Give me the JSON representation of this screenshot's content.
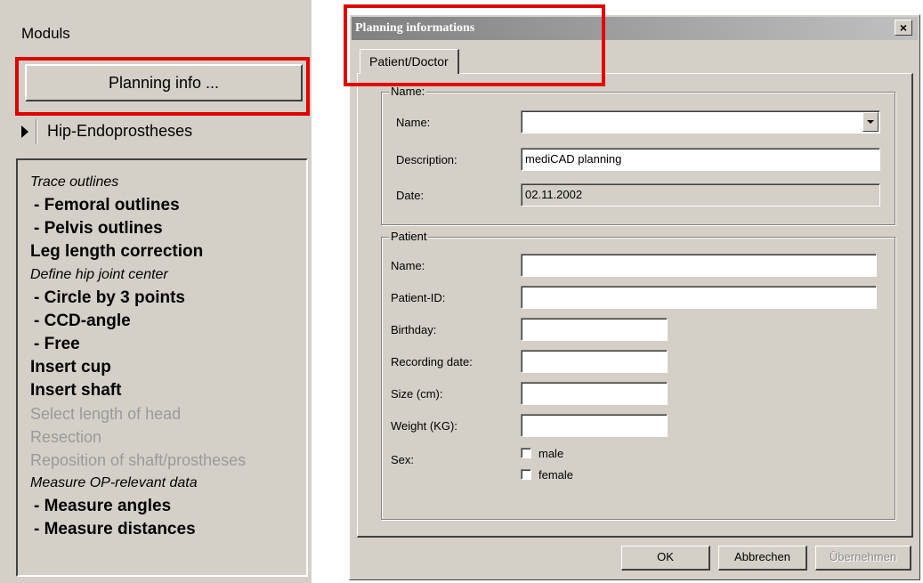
{
  "modules": {
    "title": "Moduls",
    "planning_button": "Planning info ...",
    "hip_item": "Hip-Endoprostheses",
    "steps": [
      {
        "text": "Trace outlines",
        "style": "heading"
      },
      {
        "text": "- Femoral outlines",
        "style": "bold-sub"
      },
      {
        "text": "- Pelvis outlines",
        "style": "bold-sub"
      },
      {
        "text": "Leg length correction",
        "style": "bold"
      },
      {
        "text": "Define hip joint center",
        "style": "heading"
      },
      {
        "text": "- Circle by 3 points",
        "style": "bold-sub"
      },
      {
        "text": "- CCD-angle",
        "style": "bold-sub"
      },
      {
        "text": "- Free",
        "style": "bold-sub"
      },
      {
        "text": "Insert cup",
        "style": "bold"
      },
      {
        "text": "Insert shaft",
        "style": "bold"
      },
      {
        "text": "Select length of head",
        "style": "disabled"
      },
      {
        "text": "Resection",
        "style": "disabled"
      },
      {
        "text": "Reposition of shaft/prostheses",
        "style": "disabled"
      },
      {
        "text": "Measure OP-relevant data",
        "style": "heading"
      },
      {
        "text": "- Measure angles",
        "style": "bold-sub"
      },
      {
        "text": "- Measure distances",
        "style": "bold-sub"
      }
    ]
  },
  "dialog": {
    "title": "Planning informations",
    "close_glyph": "×",
    "tab": "Patient/Doctor",
    "name_group": {
      "title": "Name:",
      "name_label": "Name:",
      "name_value": "",
      "description_label": "Description:",
      "description_value": "mediCAD planning",
      "date_label": "Date:",
      "date_value": "02.11.2002"
    },
    "patient_group": {
      "title": "Patient",
      "name_label": "Name:",
      "id_label": "Patient-ID:",
      "birthday_label": "Birthday:",
      "recording_label": "Recording date:",
      "size_label": "Size (cm):",
      "weight_label": "Weight (KG):",
      "sex_label": "Sex:",
      "male": "male",
      "female": "female"
    },
    "buttons": {
      "ok": "OK",
      "cancel": "Abbrechen",
      "apply": "Übernehmen"
    }
  },
  "colors": {
    "window_bg": "#d4d0c8",
    "highlight": "#e00000"
  }
}
